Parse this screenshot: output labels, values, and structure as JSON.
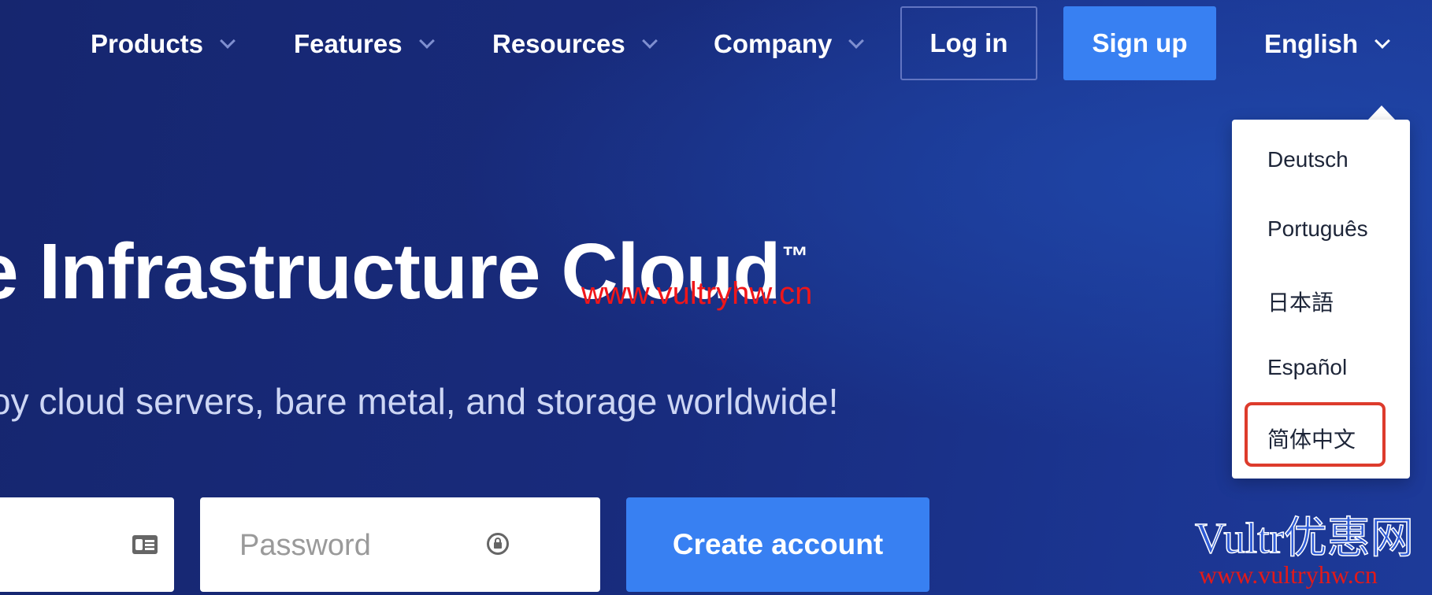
{
  "nav": {
    "items": [
      {
        "label": "Products"
      },
      {
        "label": "Features"
      },
      {
        "label": "Resources"
      },
      {
        "label": "Company"
      }
    ],
    "login_label": "Log in",
    "signup_label": "Sign up",
    "language_label": "English"
  },
  "language_menu": {
    "options": [
      "Deutsch",
      "Português",
      "日本語",
      "Español",
      "简体中文"
    ],
    "highlighted": "简体中文"
  },
  "hero": {
    "title": "e Infrastructure Cloud",
    "title_mark": "™",
    "subtitle": "oy cloud servers, bare metal, and storage worldwide!"
  },
  "form": {
    "email_value": "",
    "password_placeholder": "Password",
    "create_label": "Create account"
  },
  "watermarks": {
    "center_url": "www.vultryhw.cn",
    "corner_title": "Vultr优惠网",
    "corner_url": "www.vultryhw.cn"
  },
  "colors": {
    "background": "#182b7c",
    "primary_button": "#3880f2",
    "highlight_border": "#dd3b2c",
    "watermark_red": "#f0161a"
  }
}
